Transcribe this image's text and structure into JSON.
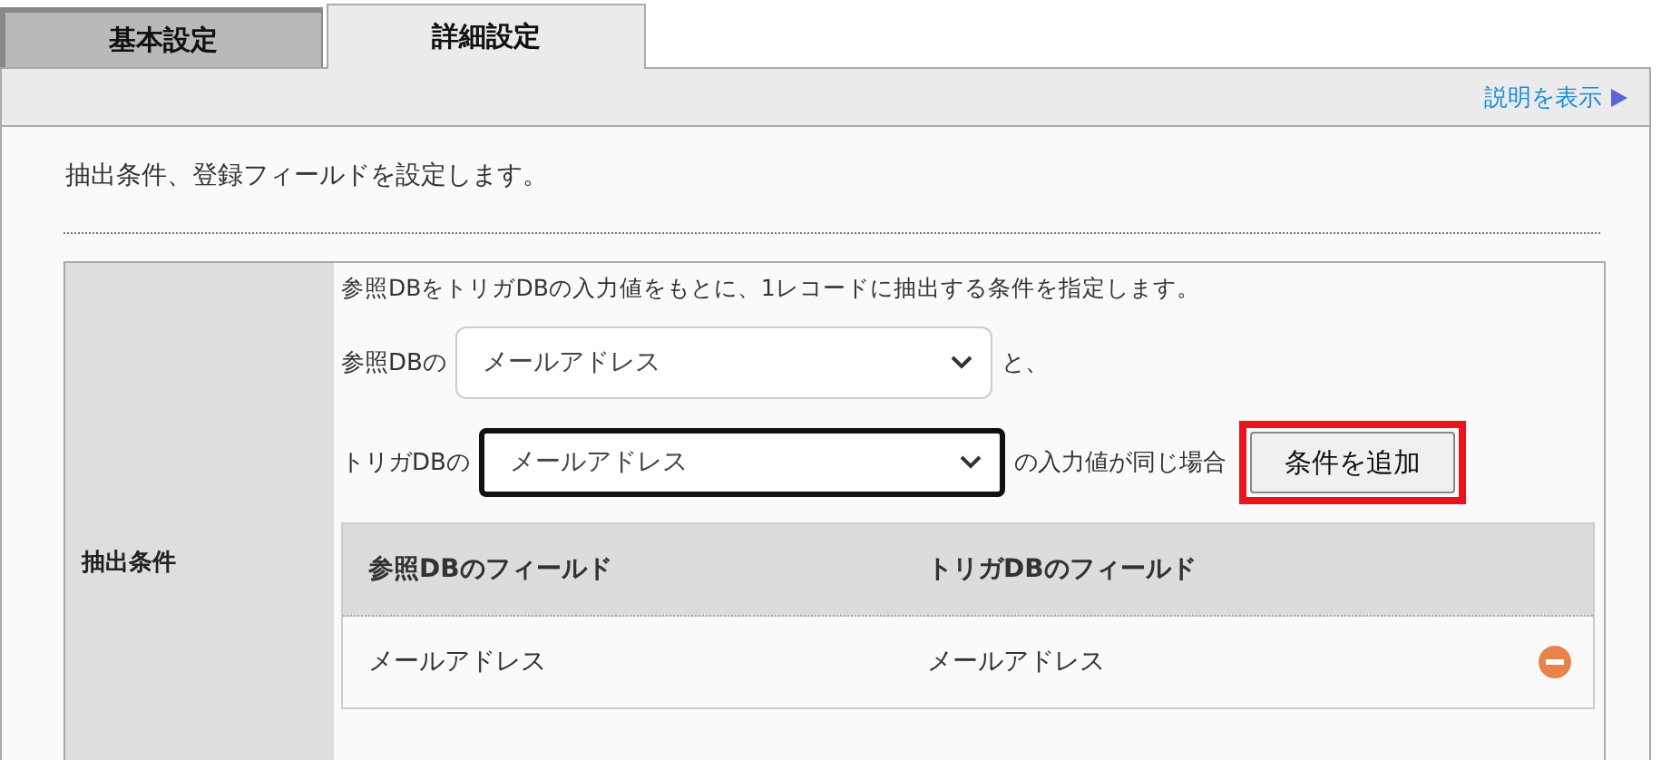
{
  "tabs": [
    {
      "label": "基本設定",
      "selected": false
    },
    {
      "label": "詳細設定",
      "selected": true
    }
  ],
  "help_link": "説明を表示",
  "intro": "抽出条件、登録フィールドを設定します。",
  "section": {
    "label": "抽出条件",
    "description": "参照DBをトリガDBの入力値をもとに、1レコードに抽出する条件を指定します。",
    "rows": [
      {
        "prefix": "参照DBの",
        "value": "メールアドレス",
        "focused": false,
        "suffix": "と、"
      },
      {
        "prefix": "トリガDBの",
        "value": "メールアドレス",
        "focused": true,
        "suffix": "の入力値が同じ場合"
      }
    ],
    "add_button": {
      "label": "条件を追加",
      "highlighted": true
    },
    "table": {
      "columns": [
        "参照DBのフィールド",
        "トリガDBのフィールド"
      ],
      "rows": [
        [
          "メールアドレス",
          "メールアドレス"
        ]
      ]
    }
  }
}
